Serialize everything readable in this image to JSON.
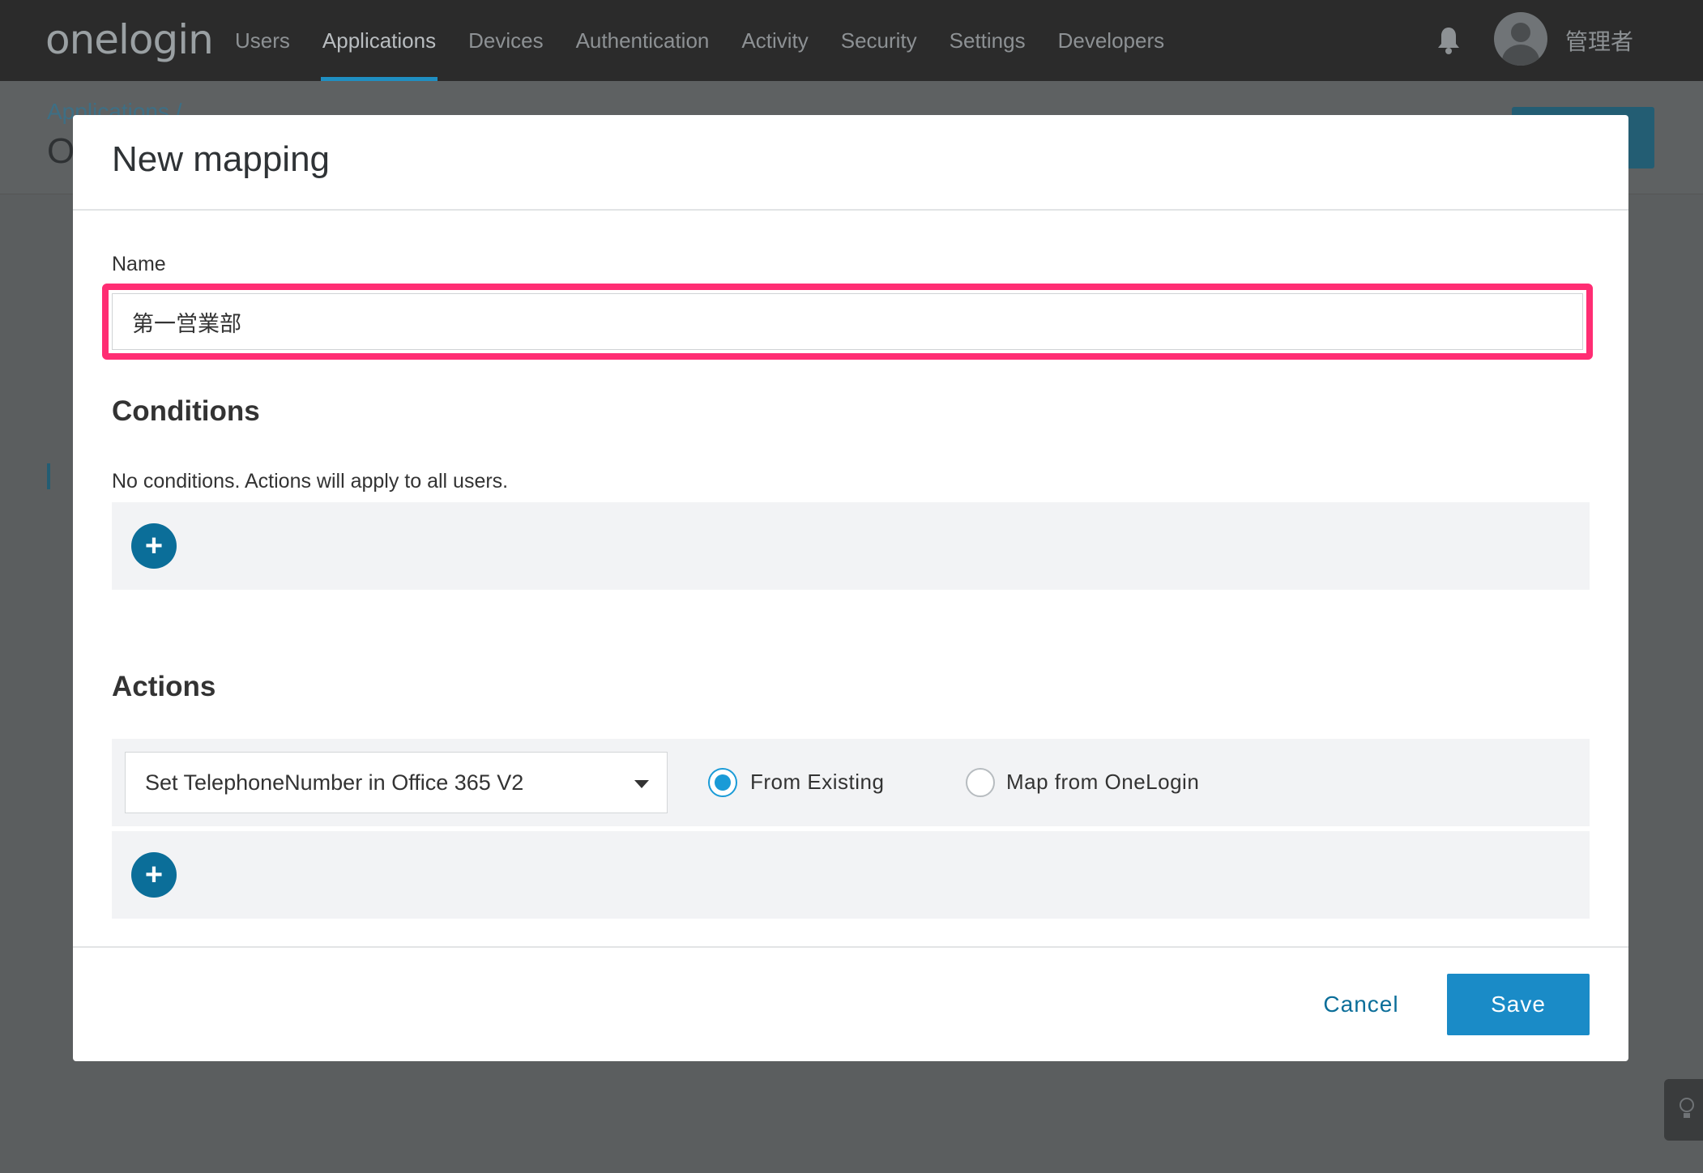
{
  "topnav": {
    "logo": "onelogin",
    "items": [
      {
        "label": "Users",
        "active": false
      },
      {
        "label": "Applications",
        "active": true
      },
      {
        "label": "Devices",
        "active": false
      },
      {
        "label": "Authentication",
        "active": false
      },
      {
        "label": "Activity",
        "active": false
      },
      {
        "label": "Security",
        "active": false
      },
      {
        "label": "Settings",
        "active": false
      },
      {
        "label": "Developers",
        "active": false
      }
    ],
    "username": "管理者",
    "icons": {
      "notifications": "bell-icon",
      "user": "avatar-icon"
    }
  },
  "background": {
    "breadcrumb": "Applications /",
    "title": "O"
  },
  "modal": {
    "title": "New mapping",
    "name_label": "Name",
    "name_value": "第一営業部",
    "conditions_heading": "Conditions",
    "conditions_empty": "No conditions. Actions will apply to all users.",
    "actions_heading": "Actions",
    "action_select_value": "Set TelephoneNumber in Office 365 V2",
    "radio_options": [
      {
        "label": "From Existing",
        "checked": true
      },
      {
        "label": "Map from OneLogin",
        "checked": false
      }
    ],
    "add_symbol": "+",
    "cancel_label": "Cancel",
    "save_label": "Save"
  },
  "colors": {
    "accent": "#1a8bc7",
    "highlight": "#ff2d73",
    "nav_bg": "#2b2b2b"
  }
}
